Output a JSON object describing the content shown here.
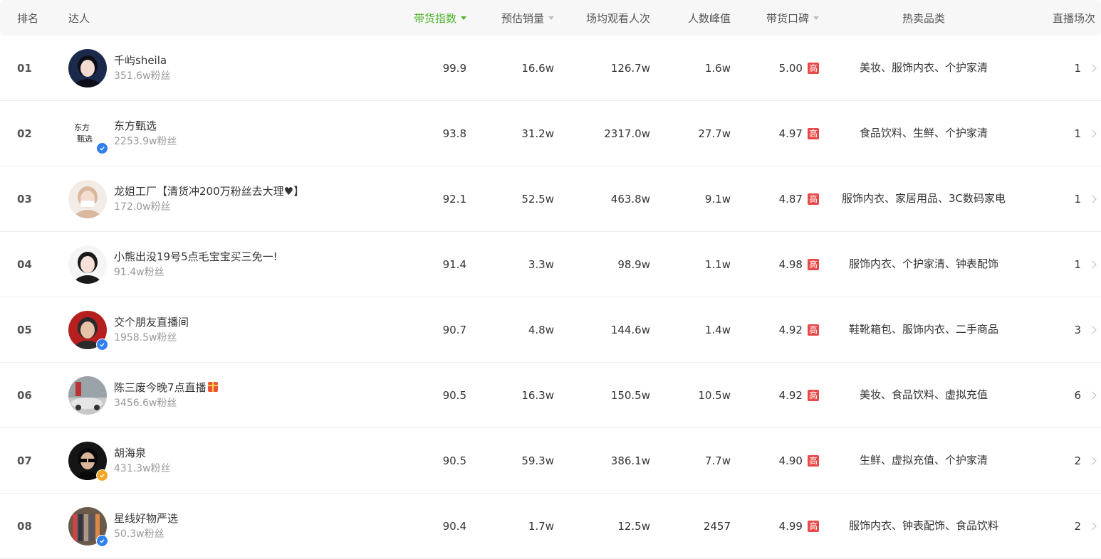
{
  "header": {
    "rank": "排名",
    "anchor": "达人",
    "index": "带货指数",
    "sales": "预估销量",
    "views": "场均观看人次",
    "peak": "人数峰值",
    "reputation": "带货口碑",
    "categories": "热卖品类",
    "live_count": "直播场次"
  },
  "colors": {
    "accent": "#4cb52a",
    "high_badge": "#e84848",
    "verified_blue": "#2f7ff0",
    "verified_gold": "#f5a623"
  },
  "rows": [
    {
      "rank": "01",
      "name": "千屿sheila",
      "fans": "351.6w粉丝",
      "index": "99.9",
      "sales": "16.6w",
      "views": "126.7w",
      "peak": "1.6w",
      "reputation": "5.00",
      "badge": "高",
      "categories": "美妆、服饰内衣、个护家清",
      "live_count": "1"
    },
    {
      "rank": "02",
      "name": "东方甄选",
      "fans": "2253.9w粉丝",
      "index": "93.8",
      "sales": "31.2w",
      "views": "2317.0w",
      "peak": "27.7w",
      "reputation": "4.97",
      "badge": "高",
      "categories": "食品饮料、生鲜、个护家清",
      "live_count": "1"
    },
    {
      "rank": "03",
      "name": "龙姐工厂【清货冲200万粉丝去大理♥】",
      "fans": "172.0w粉丝",
      "index": "92.1",
      "sales": "52.5w",
      "views": "463.8w",
      "peak": "9.1w",
      "reputation": "4.87",
      "badge": "高",
      "categories": "服饰内衣、家居用品、3C数码家电",
      "live_count": "1"
    },
    {
      "rank": "04",
      "name": "小熊出没19号5点毛宝宝买三免一!",
      "fans": "91.4w粉丝",
      "index": "91.4",
      "sales": "3.3w",
      "views": "98.9w",
      "peak": "1.1w",
      "reputation": "4.98",
      "badge": "高",
      "categories": "服饰内衣、个护家清、钟表配饰",
      "live_count": "1"
    },
    {
      "rank": "05",
      "name": "交个朋友直播间",
      "fans": "1958.5w粉丝",
      "index": "90.7",
      "sales": "4.8w",
      "views": "144.6w",
      "peak": "1.4w",
      "reputation": "4.92",
      "badge": "高",
      "categories": "鞋靴箱包、服饰内衣、二手商品",
      "live_count": "3"
    },
    {
      "rank": "06",
      "name": "陈三废今晚7点直播",
      "fans": "3456.6w粉丝",
      "index": "90.5",
      "sales": "16.3w",
      "views": "150.5w",
      "peak": "10.5w",
      "reputation": "4.92",
      "badge": "高",
      "categories": "美妆、食品饮料、虚拟充值",
      "live_count": "6"
    },
    {
      "rank": "07",
      "name": "胡海泉",
      "fans": "431.3w粉丝",
      "index": "90.5",
      "sales": "59.3w",
      "views": "386.1w",
      "peak": "7.7w",
      "reputation": "4.90",
      "badge": "高",
      "categories": "生鲜、虚拟充值、个护家清",
      "live_count": "2"
    },
    {
      "rank": "08",
      "name": "星线好物严选",
      "fans": "50.3w粉丝",
      "index": "90.4",
      "sales": "1.7w",
      "views": "12.5w",
      "peak": "2457",
      "reputation": "4.99",
      "badge": "高",
      "categories": "服饰内衣、钟表配饰、食品饮料",
      "live_count": "2"
    }
  ]
}
